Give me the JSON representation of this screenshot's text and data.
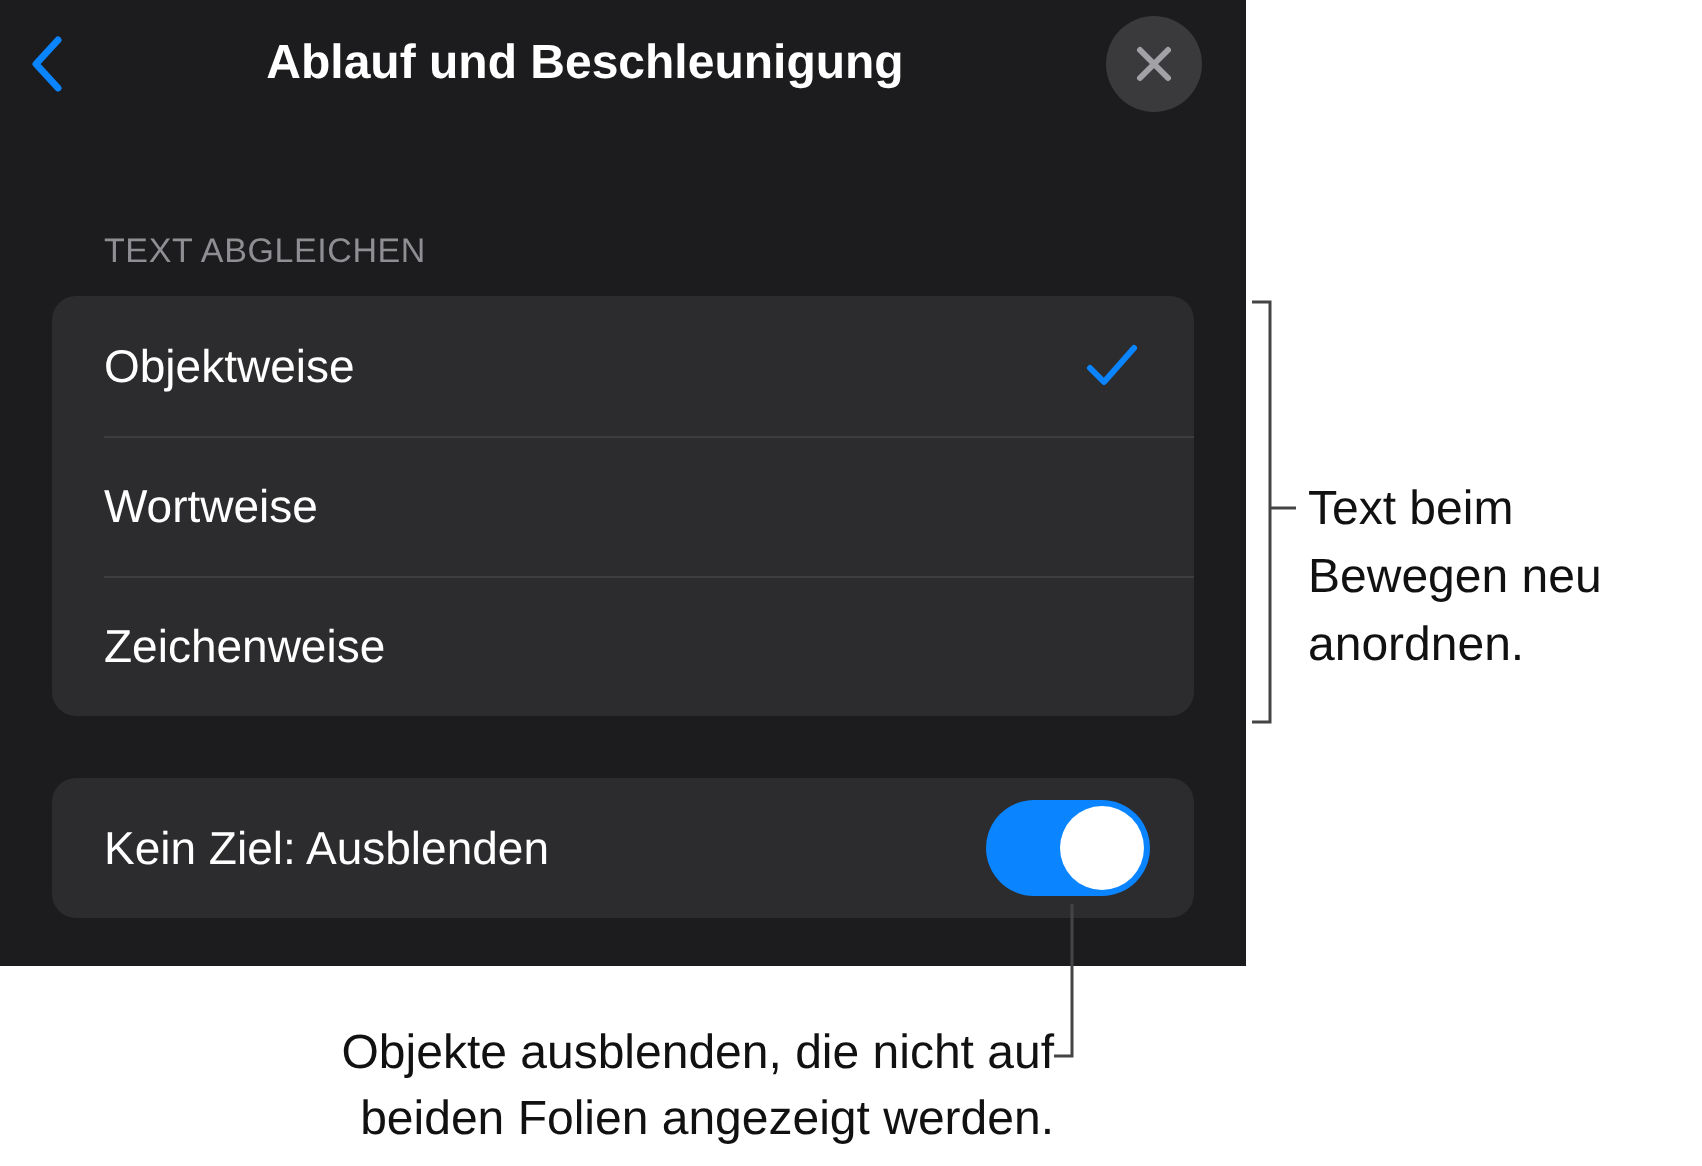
{
  "header": {
    "title": "Ablauf und Beschleunigung"
  },
  "section_label": "TEXT ABGLEICHEN",
  "options": [
    {
      "label": "Objektweise",
      "selected": true
    },
    {
      "label": "Wortweise",
      "selected": false
    },
    {
      "label": "Zeichenweise",
      "selected": false
    }
  ],
  "toggle": {
    "label": "Kein Ziel: Ausblenden",
    "on": true
  },
  "callouts": [
    {
      "kind": "bracket",
      "lines": [
        "Text beim",
        "Bewegen neu",
        "anordnen."
      ]
    },
    {
      "kind": "pointer",
      "lines": [
        "Objekte ausblenden, die nicht auf",
        "beiden Folien angezeigt werden."
      ]
    }
  ]
}
